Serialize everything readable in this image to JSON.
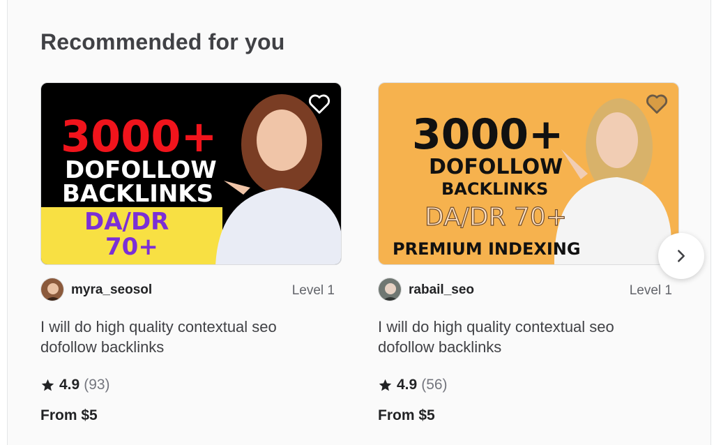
{
  "section": {
    "title": "Recommended for you"
  },
  "gigs": [
    {
      "image_text": {
        "headline": "3000+",
        "line1": "DOFOLLOW",
        "line2": "BACKLINKS",
        "line3": "DA/DR",
        "line4": "70+"
      },
      "seller": "myra_seosol",
      "level": "Level 1",
      "title": "I will do high quality contextual seo dofollow backlinks",
      "rating": "4.9",
      "reviews": "(93)",
      "price": "From $5"
    },
    {
      "image_text": {
        "headline": "3000+",
        "line1": "DOFOLLOW",
        "line2": "BACKLINKS",
        "line3": "DA/DR 70+",
        "line4": "PREMIUM INDEXING"
      },
      "seller": "rabail_seo",
      "level": "Level 1",
      "title": "I will do high quality contextual seo dofollow backlinks",
      "rating": "4.9",
      "reviews": "(56)",
      "price": "From $5"
    }
  ],
  "icons": {
    "favorite": "heart-icon",
    "rating": "star-icon",
    "next": "chevron-right-icon"
  },
  "colors": {
    "headline_red": "#f1141c",
    "purple": "#7b2fd6",
    "banner_yellow": "#f8e043",
    "orange_bg": "#f6b24e"
  }
}
